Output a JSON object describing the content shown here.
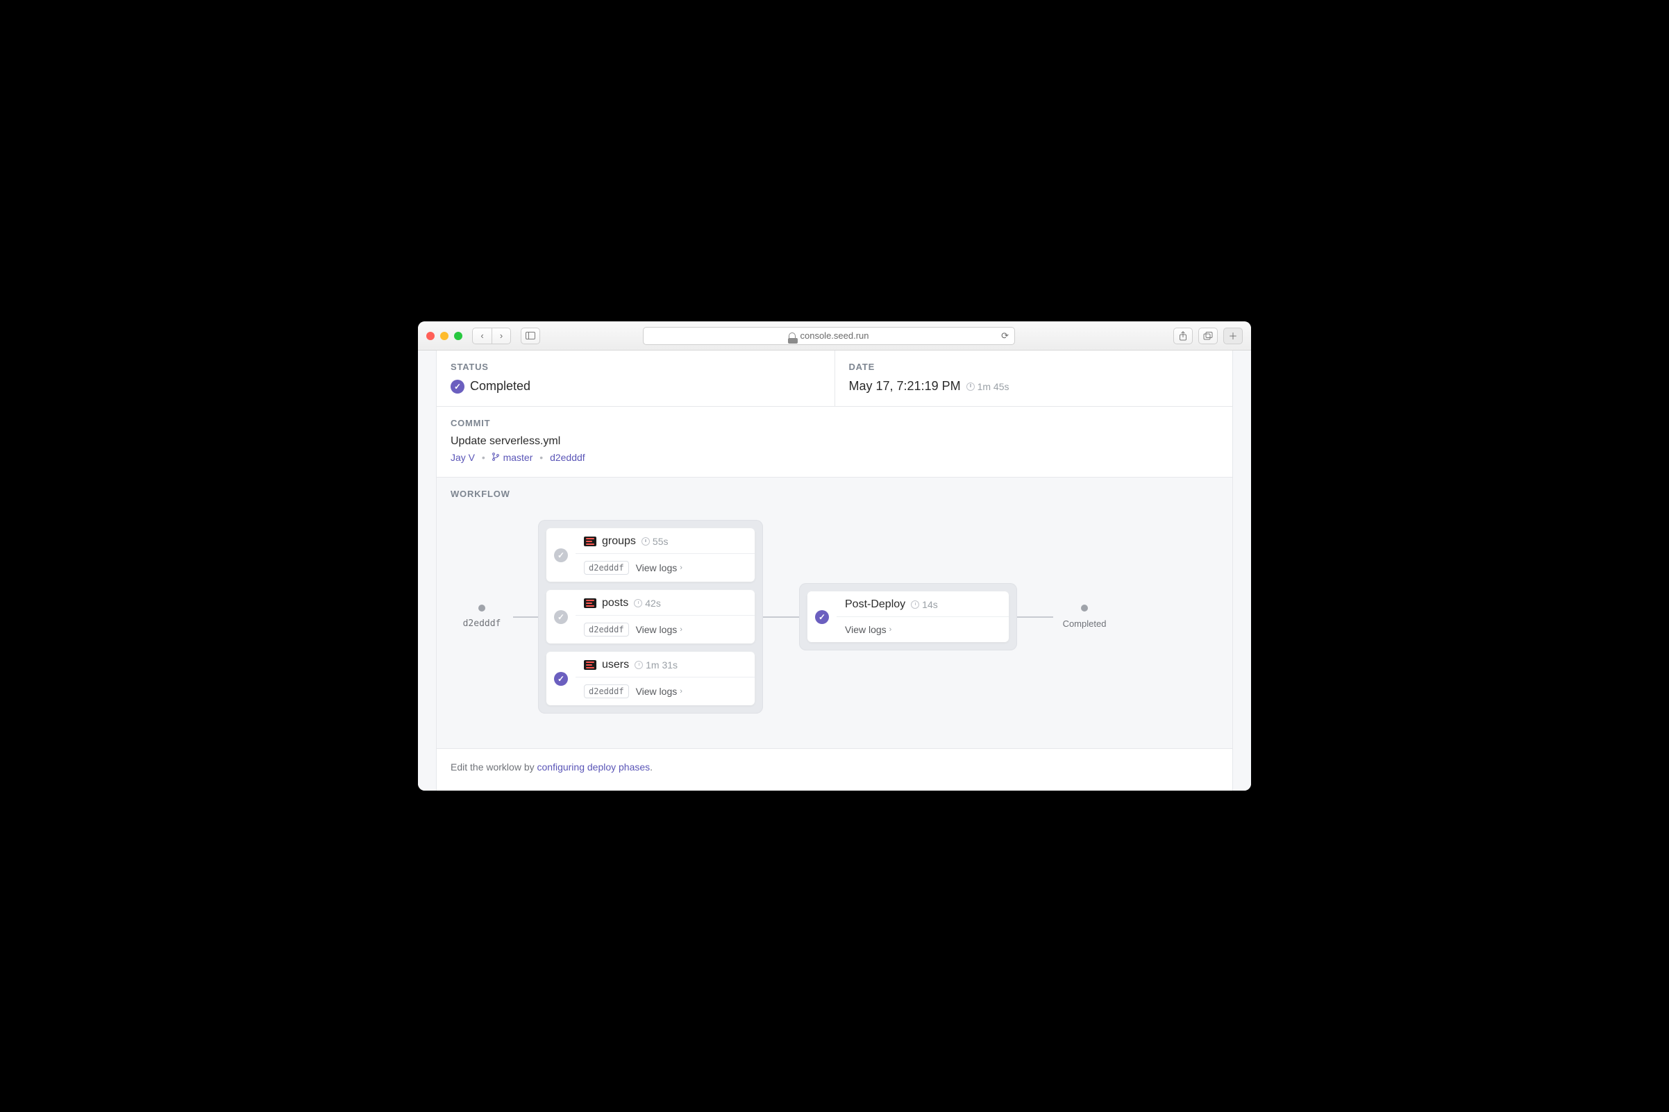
{
  "browser": {
    "url_host": "console.seed.run"
  },
  "header": {
    "status_label": "STATUS",
    "status_value": "Completed",
    "date_label": "DATE",
    "date_value": "May 17, 7:21:19 PM",
    "date_duration": "1m 45s"
  },
  "commit": {
    "label": "COMMIT",
    "message": "Update serverless.yml",
    "author": "Jay V",
    "branch": "master",
    "hash": "d2edddf"
  },
  "workflow": {
    "label": "WORKFLOW",
    "start_hash": "d2edddf",
    "end_label": "Completed",
    "phase1": [
      {
        "name": "groups",
        "duration": "55s",
        "hash": "d2edddf",
        "logs": "View logs",
        "accent": "gray"
      },
      {
        "name": "posts",
        "duration": "42s",
        "hash": "d2edddf",
        "logs": "View logs",
        "accent": "gray"
      },
      {
        "name": "users",
        "duration": "1m 31s",
        "hash": "d2edddf",
        "logs": "View logs",
        "accent": "purple"
      }
    ],
    "phase2": {
      "name": "Post-Deploy",
      "duration": "14s",
      "logs": "View logs"
    }
  },
  "footer": {
    "pre": "Edit the worklow by ",
    "link": "configuring deploy phases",
    "post": "."
  }
}
